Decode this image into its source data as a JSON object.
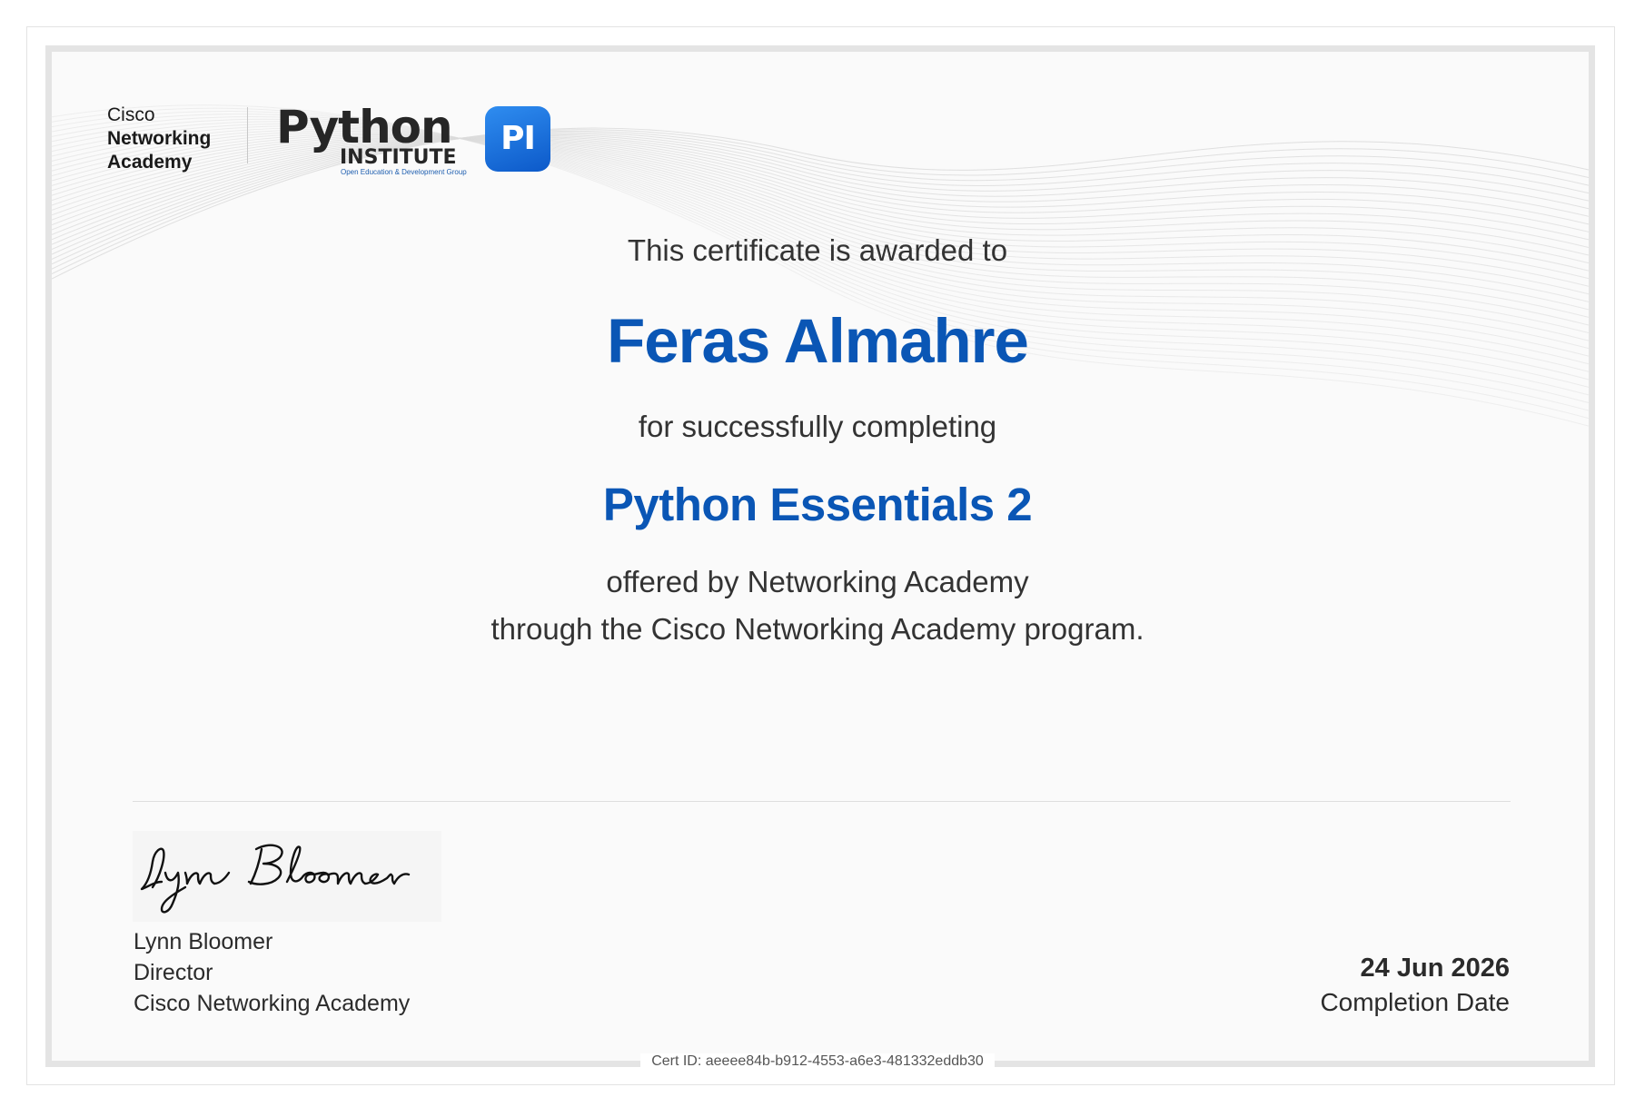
{
  "logos": {
    "cisco_line1": "Cisco",
    "cisco_line2": "Networking",
    "cisco_line3": "Academy",
    "python_word": "Python",
    "python_institute": "INSTITUTE",
    "python_subtitle": "Open Education & Development Group",
    "python_badge": "PI",
    "badge_color": "#1a73e8"
  },
  "certificate": {
    "awarded_text": "This certificate is awarded to",
    "recipient_name": "Feras Almahre",
    "completing_text": "for successfully completing",
    "course_name": "Python Essentials 2",
    "offered_text": "offered by Networking Academy",
    "through_text": "through the Cisco Networking Academy program.",
    "accent_color": "#0a56b5"
  },
  "signatory": {
    "signature": "Lynn Bloomer",
    "name": "Lynn Bloomer",
    "title": "Director",
    "organization": "Cisco Networking Academy"
  },
  "completion": {
    "date": "24 Jun 2026",
    "label": "Completion Date"
  },
  "cert_id": "Cert ID: aeeee84b-b912-4553-a6e3-481332eddb30"
}
